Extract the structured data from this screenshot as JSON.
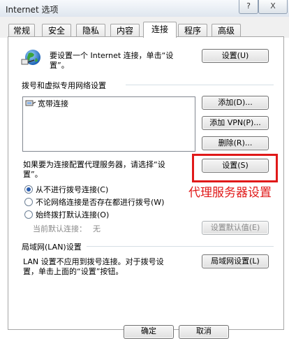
{
  "window": {
    "title": "Internet 选项",
    "help_label": "?",
    "close_label": "X"
  },
  "tabs": [
    {
      "label": "常规"
    },
    {
      "label": "安全"
    },
    {
      "label": "隐私"
    },
    {
      "label": "内容"
    },
    {
      "label": "连接",
      "active": true
    },
    {
      "label": "程序"
    },
    {
      "label": "高级"
    }
  ],
  "setup": {
    "text_line1": "要设置一个 Internet 连接，单击“设",
    "text_line2": "置”。",
    "button_label": "设置(U)"
  },
  "dialup_section": {
    "heading": "拨号和虚拟专用网络设置",
    "connections": [
      "宽带连接"
    ],
    "add_button": "添加(D)...",
    "add_vpn_button": "添加 VPN(P)...",
    "remove_button": "删除(R)..."
  },
  "proxy": {
    "text_line1": "如果要为连接配置代理服务器，请选择“设",
    "text_line2": "置”。",
    "settings_button": "设置(S)",
    "annotation": "代理服务器设置"
  },
  "dial_options": {
    "options": [
      {
        "label": "从不进行拨号连接(C)",
        "selected": true
      },
      {
        "label": "不论网络连接是否存在都进行拨号(W)",
        "selected": false
      },
      {
        "label": "始终拨打默认连接(O)",
        "selected": false
      }
    ],
    "current_default_label": "当前默认连接：",
    "current_default_value": "无",
    "set_default_button": "设置默认值(E)"
  },
  "lan": {
    "heading": "局域网(LAN)设置",
    "text_line1": "LAN 设置不应用到拨号连接。对于拨号设",
    "text_line2": "置，单击上面的“设置”按钮。",
    "button_label": "局域网设置(L)"
  },
  "footer": {
    "ok_button": "确定",
    "cancel_button": "取消"
  }
}
